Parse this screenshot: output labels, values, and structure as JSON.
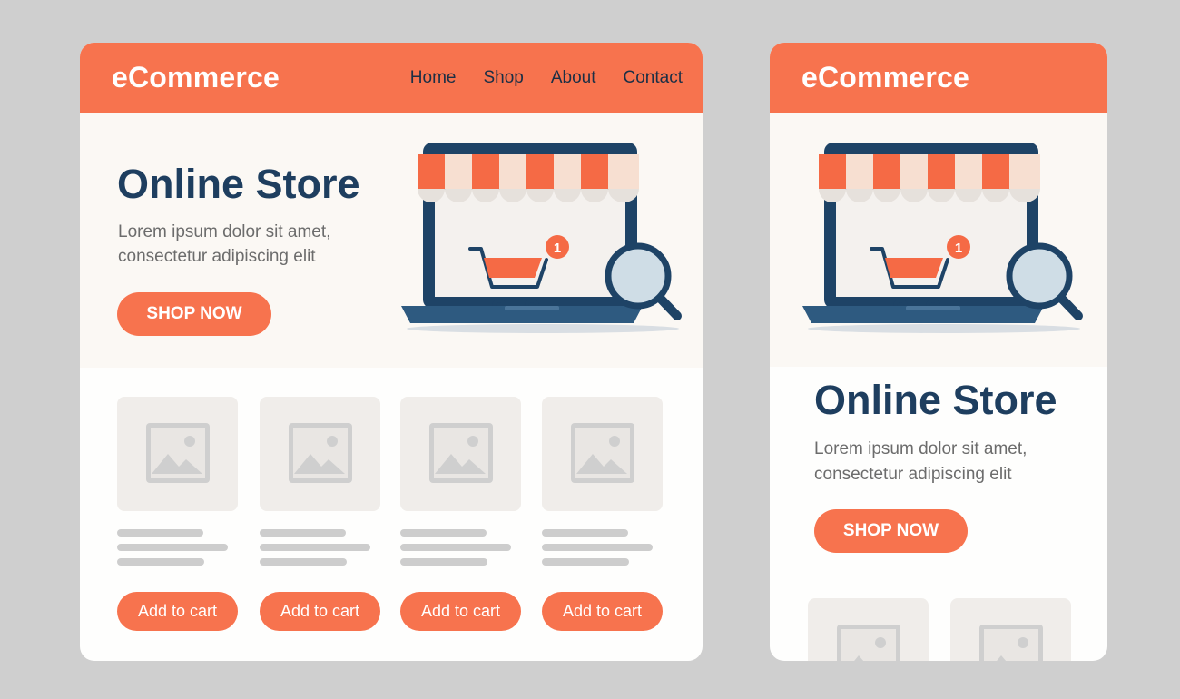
{
  "desktop": {
    "logo": "eCommerce",
    "nav": [
      "Home",
      "Shop",
      "About",
      "Contact"
    ],
    "hero": {
      "title": "Online Store",
      "subtitle_line1": "Lorem ipsum dolor sit amet,",
      "subtitle_line2": "consectetur adipiscing elit",
      "cta": "SHOP NOW"
    },
    "products": [
      {
        "button": "Add to cart"
      },
      {
        "button": "Add to cart"
      },
      {
        "button": "Add to cart"
      },
      {
        "button": "Add to cart"
      }
    ],
    "cart_badge": "1"
  },
  "mobile": {
    "logo": "eCommerce",
    "hero": {
      "title": "Online Store",
      "subtitle_line1": "Lorem ipsum dolor sit amet,",
      "subtitle_line2": "consectetur adipiscing elit",
      "cta": "SHOP NOW"
    },
    "cart_badge": "1"
  },
  "colors": {
    "accent": "#f7734e",
    "navy": "#1e3e5f",
    "background": "#cfcfcf"
  },
  "icons": [
    "storefront-laptop-icon",
    "shopping-cart-icon",
    "magnifier-icon",
    "image-placeholder-icon"
  ]
}
